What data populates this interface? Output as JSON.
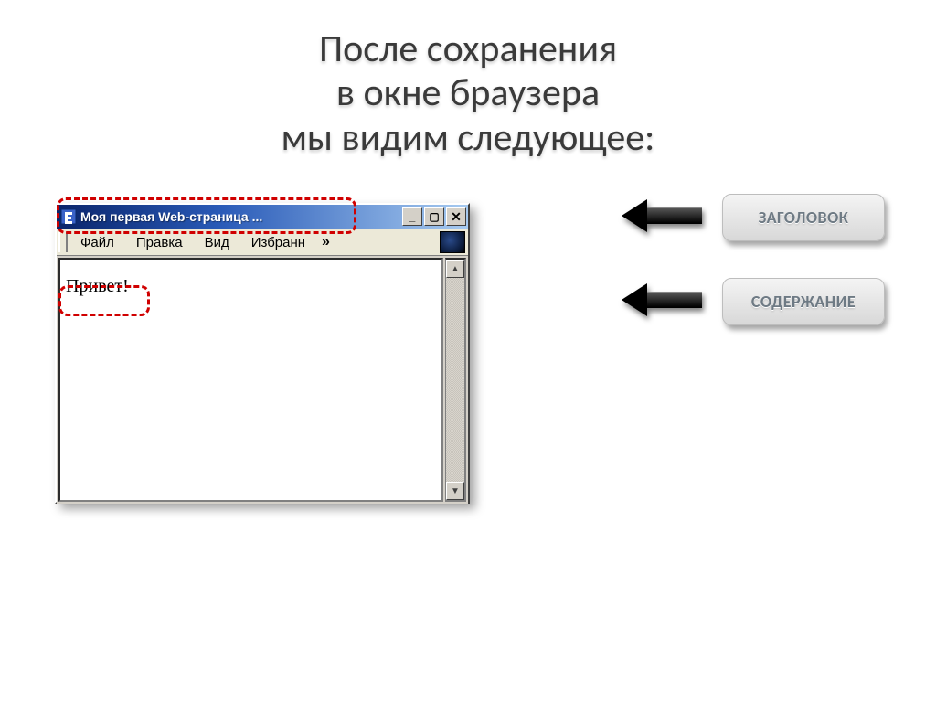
{
  "heading": {
    "line1": "После сохранения",
    "line2": "в окне браузера",
    "line3": "мы видим следующее:"
  },
  "browser": {
    "title": "Моя первая Web-страница ...",
    "minimize_glyph": "_",
    "maximize_glyph": "▢",
    "close_glyph": "✕",
    "menu": {
      "file": "Файл",
      "edit": "Правка",
      "view": "Вид",
      "favorites": "Избранн",
      "more_glyph": "»"
    },
    "scroll_up_glyph": "▲",
    "scroll_down_glyph": "▼",
    "page_text": "Привет!"
  },
  "labels": {
    "title": "ЗАГОЛОВОК",
    "content": "СОДЕРЖАНИЕ"
  }
}
